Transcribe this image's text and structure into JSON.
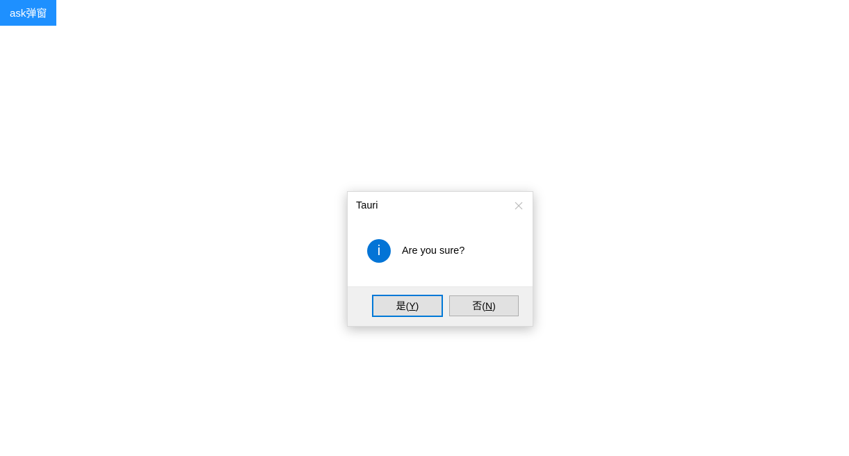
{
  "trigger": {
    "label": "ask弹窗"
  },
  "dialog": {
    "title": "Tauri",
    "icon_glyph": "i",
    "message": "Are you sure?",
    "buttons": {
      "yes": {
        "prefix": "是(",
        "accel": "Y",
        "suffix": ")"
      },
      "no": {
        "prefix": "否(",
        "accel": "N",
        "suffix": ")"
      }
    }
  }
}
